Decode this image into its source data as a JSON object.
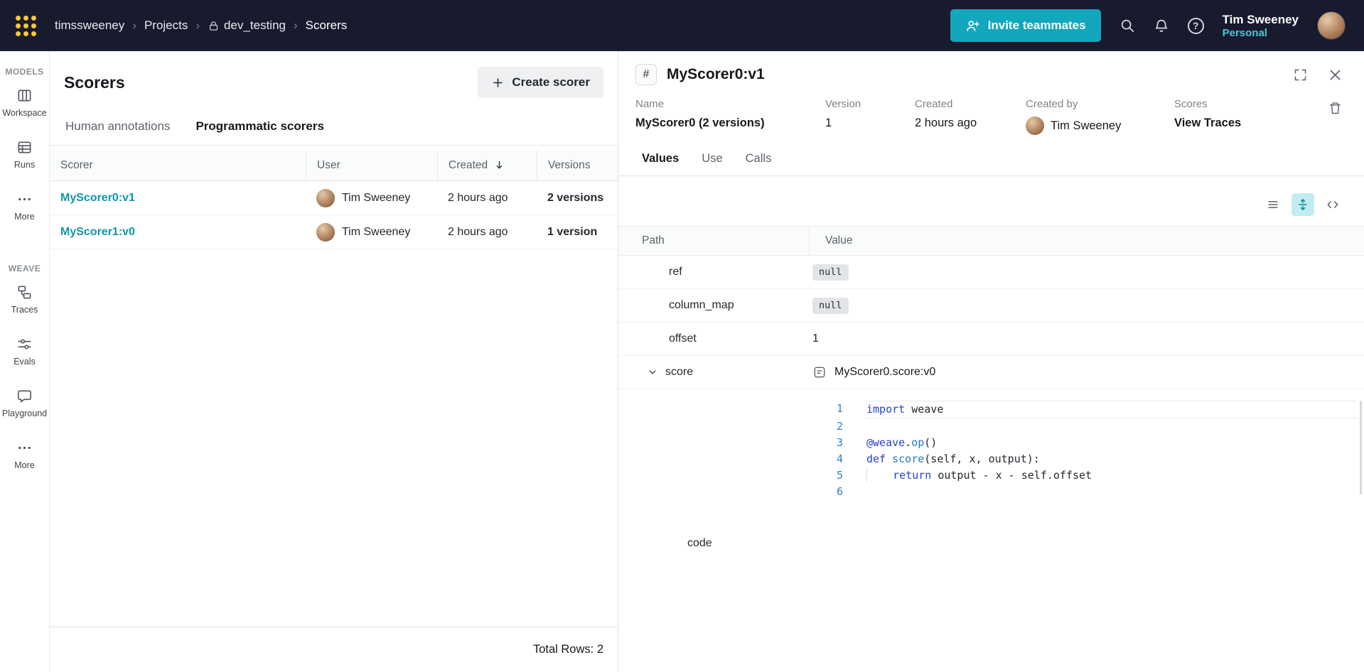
{
  "colors": {
    "navbar_bg": "#181a2e",
    "accent_teal": "#12a7bd",
    "link_teal": "#0e97ad",
    "personal_teal": "#49c6d6",
    "active_tool_bg": "#c2ecf1",
    "logo_gold": "#ffc933",
    "code_keyword": "#2743cf",
    "code_function": "#2676c9",
    "line_number_blue": "#327dc7"
  },
  "navbar": {
    "breadcrumb": [
      "timssweeney",
      "Projects",
      "dev_testing",
      "Scorers"
    ],
    "invite_label": "Invite teammates",
    "user_name": "Tim Sweeney",
    "user_scope": "Personal"
  },
  "sidebar": {
    "sections": [
      {
        "title": "MODELS",
        "items": [
          {
            "label": "Workspace"
          },
          {
            "label": "Runs"
          },
          {
            "label": "More"
          }
        ]
      },
      {
        "title": "WEAVE",
        "items": [
          {
            "label": "Traces"
          },
          {
            "label": "Evals"
          },
          {
            "label": "Playground"
          },
          {
            "label": "More"
          }
        ]
      }
    ]
  },
  "scorers": {
    "title": "Scorers",
    "create_label": "Create scorer",
    "tabs": [
      "Human annotations",
      "Programmatic scorers"
    ],
    "active_tab": "Programmatic scorers",
    "table": {
      "headers": [
        "Scorer",
        "User",
        "Created",
        "Versions"
      ],
      "rows": [
        {
          "scorer": "MyScorer0:v1",
          "user": "Tim Sweeney",
          "created": "2 hours ago",
          "versions": "2 versions"
        },
        {
          "scorer": "MyScorer1:v0",
          "user": "Tim Sweeney",
          "created": "2 hours ago",
          "versions": "1 version"
        }
      ]
    },
    "total": "Total Rows: 2"
  },
  "detail": {
    "title": "MyScorer0:v1",
    "meta": {
      "name": {
        "label": "Name",
        "value": "MyScorer0 (2 versions)"
      },
      "version": {
        "label": "Version",
        "value": "1"
      },
      "created": {
        "label": "Created",
        "value": "2 hours ago"
      },
      "created_by": {
        "label": "Created by",
        "value": "Tim Sweeney"
      },
      "scores": {
        "label": "Scores",
        "value": "View Traces"
      }
    },
    "tabs": [
      "Values",
      "Use",
      "Calls"
    ],
    "active_tab": "Values",
    "values": {
      "headers": [
        "Path",
        "Value"
      ],
      "rows": {
        "ref": {
          "path": "ref",
          "value": "null"
        },
        "column_map": {
          "path": "column_map",
          "value": "null"
        },
        "offset": {
          "path": "offset",
          "value": "1"
        },
        "score": {
          "path": "score",
          "value": "MyScorer0.score:v0"
        },
        "code": {
          "path": "code"
        }
      }
    },
    "code": {
      "lines": [
        {
          "n": "1",
          "seg": [
            {
              "c": "kw",
              "t": "import"
            },
            {
              "c": "pl",
              "t": " weave"
            }
          ]
        },
        {
          "n": "2",
          "seg": []
        },
        {
          "n": "3",
          "seg": [
            {
              "c": "kw",
              "t": "@weave"
            },
            {
              "c": "pl",
              "t": "."
            },
            {
              "c": "fn",
              "t": "op"
            },
            {
              "c": "pl",
              "t": "()"
            }
          ]
        },
        {
          "n": "4",
          "seg": [
            {
              "c": "kw",
              "t": "def"
            },
            {
              "c": "pl",
              "t": " "
            },
            {
              "c": "fn",
              "t": "score"
            },
            {
              "c": "pl",
              "t": "(self, x, output):"
            }
          ]
        },
        {
          "n": "5",
          "seg": [
            {
              "c": "ind",
              "t": "    "
            },
            {
              "c": "kw",
              "t": "return"
            },
            {
              "c": "pl",
              "t": " output - x - self.offset"
            }
          ]
        },
        {
          "n": "6",
          "seg": []
        }
      ]
    }
  }
}
